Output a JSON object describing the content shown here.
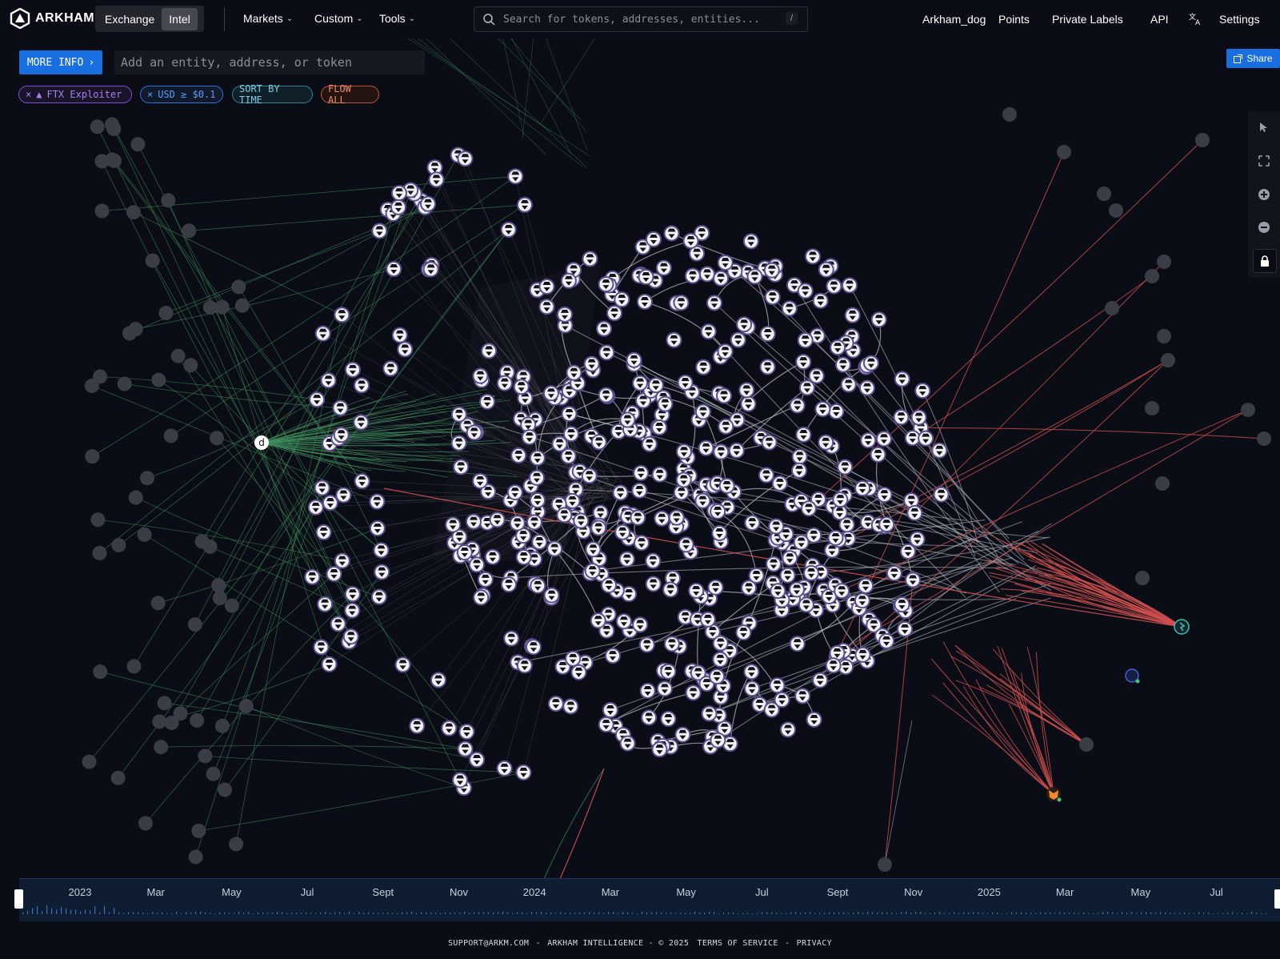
{
  "app": {
    "name": "ARKHAM"
  },
  "mode_switch": {
    "options": [
      {
        "label": "Exchange",
        "active": false
      },
      {
        "label": "Intel",
        "active": true
      }
    ]
  },
  "nav": {
    "menus": [
      {
        "label": "Markets"
      },
      {
        "label": "Custom"
      },
      {
        "label": "Tools"
      }
    ],
    "right": [
      {
        "label": "Arkham_dog"
      },
      {
        "label": "Points"
      },
      {
        "label": "Private Labels"
      },
      {
        "label": "API"
      },
      {
        "label": "Settings"
      }
    ]
  },
  "search": {
    "placeholder": "Search for tokens, addresses, entities...",
    "shortcut": "/"
  },
  "more_info": {
    "label": "MORE INFO"
  },
  "entity_input": {
    "placeholder": "Add an entity, address, or token"
  },
  "share": {
    "label": "Share"
  },
  "filters": [
    {
      "label": "FTX Exploiter",
      "removable": true,
      "color": "#a67ff5"
    },
    {
      "label": "USD ≥ $0.1",
      "removable": true,
      "color": "#5d9cf2"
    },
    {
      "label": "SORT BY TIME",
      "removable": false,
      "color": "#7ecbe0"
    },
    {
      "label": "FLOW ALL",
      "removable": false,
      "color": "#f08a6c"
    }
  ],
  "graph": {
    "colors": {
      "inflow": "#3f8f5c",
      "outflow": "#d0504f",
      "internal": "#b9bcc6",
      "node_fill": "#f2f2f5",
      "node_ring": "#5a4f8c",
      "label_node": "#3a3c46"
    },
    "center_marker": "d",
    "icons": [
      "hacker-icon",
      "exchange-icon",
      "fox-icon",
      "bridge-icon"
    ]
  },
  "toolbar": {
    "tools": [
      "pointer-icon",
      "fit-screen-icon",
      "zoom-in-icon",
      "zoom-out-icon",
      "lock-icon"
    ]
  },
  "timeline": {
    "labels": [
      "2023",
      "Mar",
      "May",
      "Jul",
      "Sept",
      "Nov",
      "2024",
      "Mar",
      "May",
      "Jul",
      "Sept",
      "Nov",
      "2025",
      "Mar",
      "May",
      "Jul"
    ]
  },
  "footer": {
    "support": "SUPPORT@ARKM.COM",
    "company": "ARKHAM INTELLIGENCE - © 2025",
    "terms": "TERMS OF SERVICE",
    "privacy": "PRIVACY"
  }
}
